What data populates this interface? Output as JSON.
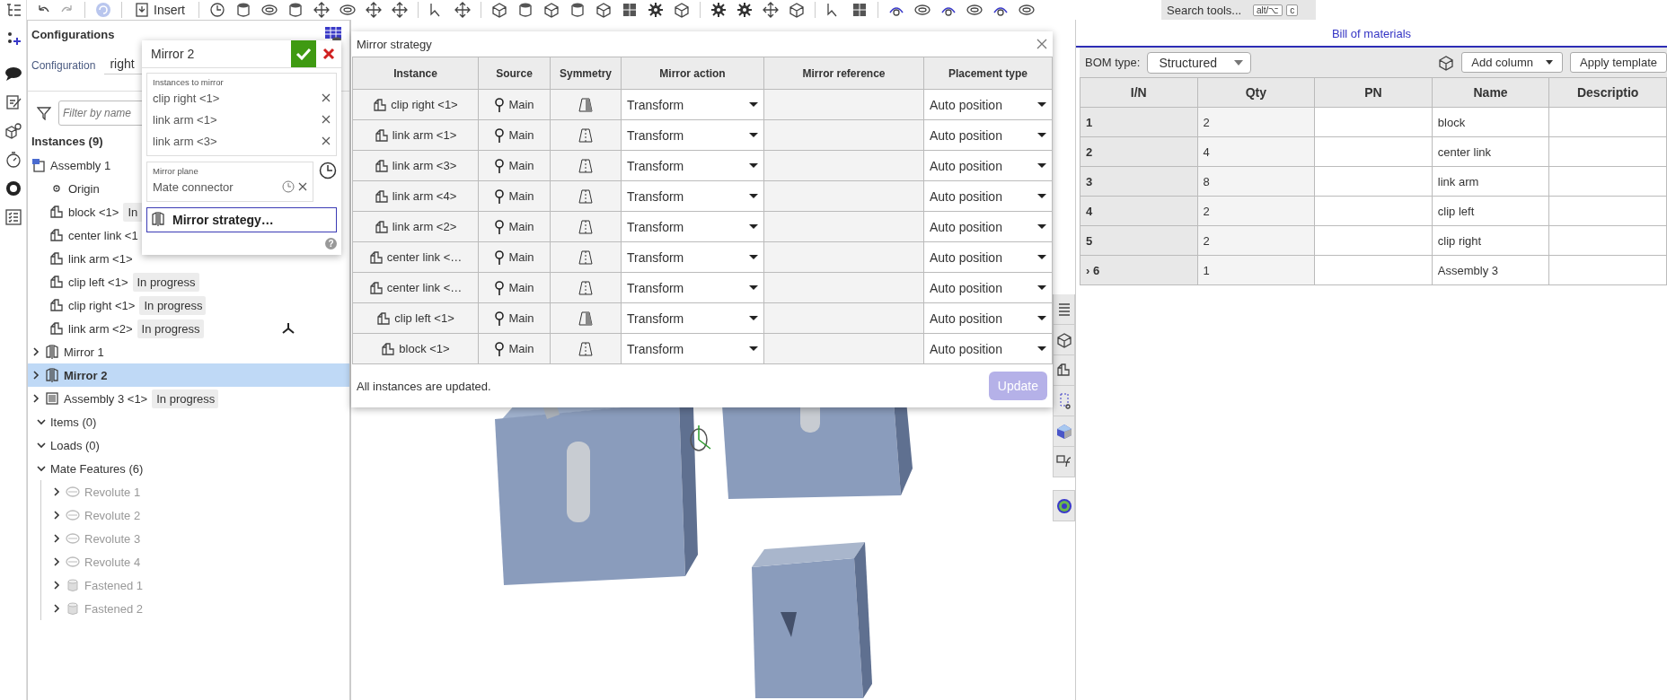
{
  "toolbar": {
    "insert": "Insert",
    "search_placeholder": "Search tools...",
    "shortcut_keys": [
      "alt/⌥",
      "c"
    ]
  },
  "left_panel": {
    "title": "Configurations",
    "configuration": {
      "label": "Configuration",
      "value": "right"
    },
    "filter": {
      "placeholder": "Filter by name"
    },
    "instances_header": "Instances (9)",
    "tree": [
      {
        "label": "Assembly 1",
        "kind": "assembly",
        "selected": false,
        "children": [
          {
            "label": "Origin",
            "kind": "origin",
            "selected": false
          },
          {
            "label": "block <1>",
            "kind": "part",
            "selected": false,
            "badge": "In"
          },
          {
            "label": "center link <1",
            "kind": "part",
            "selected": false
          },
          {
            "label": "link arm <1>",
            "kind": "part",
            "selected": false
          },
          {
            "label": "clip left <1>",
            "kind": "part",
            "selected": false,
            "badge": "In progress"
          },
          {
            "label": "clip right <1>",
            "kind": "part",
            "selected": false,
            "badge": "In progress"
          },
          {
            "label": "link arm <2>",
            "kind": "part",
            "selected": false,
            "badge": "In progress",
            "connector": true
          }
        ]
      },
      {
        "label": "Mirror 1",
        "kind": "mirror",
        "expanded": false,
        "selected": false
      },
      {
        "label": "Mirror 2",
        "kind": "mirror",
        "expanded": false,
        "selected": true
      },
      {
        "label": "Assembly 3 <1>",
        "kind": "subassembly",
        "expanded": false,
        "selected": false,
        "badge": "In progress"
      }
    ],
    "sections": [
      {
        "label": "Items (0)",
        "expanded": true
      },
      {
        "label": "Loads (0)",
        "expanded": true
      },
      {
        "label": "Mate Features (6)",
        "expanded": true,
        "children": [
          {
            "label": "Revolute 1",
            "kind": "revolute",
            "expanded": false,
            "disabled": true
          },
          {
            "label": "Revolute 2",
            "kind": "revolute",
            "expanded": false,
            "disabled": true
          },
          {
            "label": "Revolute 3",
            "kind": "revolute",
            "expanded": false,
            "disabled": true
          },
          {
            "label": "Revolute 4",
            "kind": "revolute",
            "expanded": false,
            "disabled": true
          },
          {
            "label": "Fastened 1",
            "kind": "fastened",
            "expanded": false,
            "disabled": true
          },
          {
            "label": "Fastened 2",
            "kind": "fastened",
            "expanded": false,
            "disabled": true
          }
        ]
      }
    ]
  },
  "feature_dialog": {
    "title": "Mirror 2",
    "instances_label": "Instances to mirror",
    "instances": [
      "clip right <1>",
      "link arm <1>",
      "link arm <3>"
    ],
    "plane_label": "Mirror plane",
    "plane_value": "Mate connector",
    "strategy_button": {
      "label": "Mirror strategy…",
      "selected": true
    },
    "help": "?"
  },
  "strategy_dialog": {
    "title": "Mirror strategy",
    "columns": [
      "Instance",
      "Source",
      "Symmetry",
      "Mirror action",
      "Mirror reference",
      "Placement type"
    ],
    "rows": [
      {
        "instance": "clip right <1>",
        "source": "Main",
        "symmetric": false,
        "action": "Transform",
        "placement": "Auto position"
      },
      {
        "instance": "link arm <1>",
        "source": "Main",
        "symmetric": true,
        "action": "Transform",
        "placement": "Auto position"
      },
      {
        "instance": "link arm <3>",
        "source": "Main",
        "symmetric": true,
        "action": "Transform",
        "placement": "Auto position"
      },
      {
        "instance": "link arm <4>",
        "source": "Main",
        "symmetric": true,
        "action": "Transform",
        "placement": "Auto position"
      },
      {
        "instance": "link arm <2>",
        "source": "Main",
        "symmetric": true,
        "action": "Transform",
        "placement": "Auto position"
      },
      {
        "instance": "center link <…",
        "source": "Main",
        "symmetric": true,
        "action": "Transform",
        "placement": "Auto position"
      },
      {
        "instance": "center link <…",
        "source": "Main",
        "symmetric": true,
        "action": "Transform",
        "placement": "Auto position"
      },
      {
        "instance": "clip left <1>",
        "source": "Main",
        "symmetric": false,
        "action": "Transform",
        "placement": "Auto position"
      },
      {
        "instance": "block <1>",
        "source": "Main",
        "symmetric": true,
        "action": "Transform",
        "placement": "Auto position"
      }
    ],
    "status": "All instances are updated.",
    "update_button": {
      "label": "Update",
      "disabled": true
    }
  },
  "bom": {
    "title": "Bill of materials",
    "type_label": "BOM type:",
    "type_value": "Structured",
    "buttons": [
      "Add column",
      "Apply template"
    ],
    "columns": [
      "I/N",
      "Qty",
      "PN",
      "Name",
      "Descriptio"
    ],
    "rows": [
      {
        "item": "1",
        "qty": "2",
        "name": "block"
      },
      {
        "item": "2",
        "qty": "4",
        "name": "center link"
      },
      {
        "item": "3",
        "qty": "8",
        "name": "link arm"
      },
      {
        "item": "4",
        "qty": "2",
        "name": "clip left"
      },
      {
        "item": "5",
        "qty": "2",
        "name": "clip right"
      },
      {
        "item": "› 6",
        "qty": "1",
        "name": "Assembly 3"
      }
    ]
  }
}
